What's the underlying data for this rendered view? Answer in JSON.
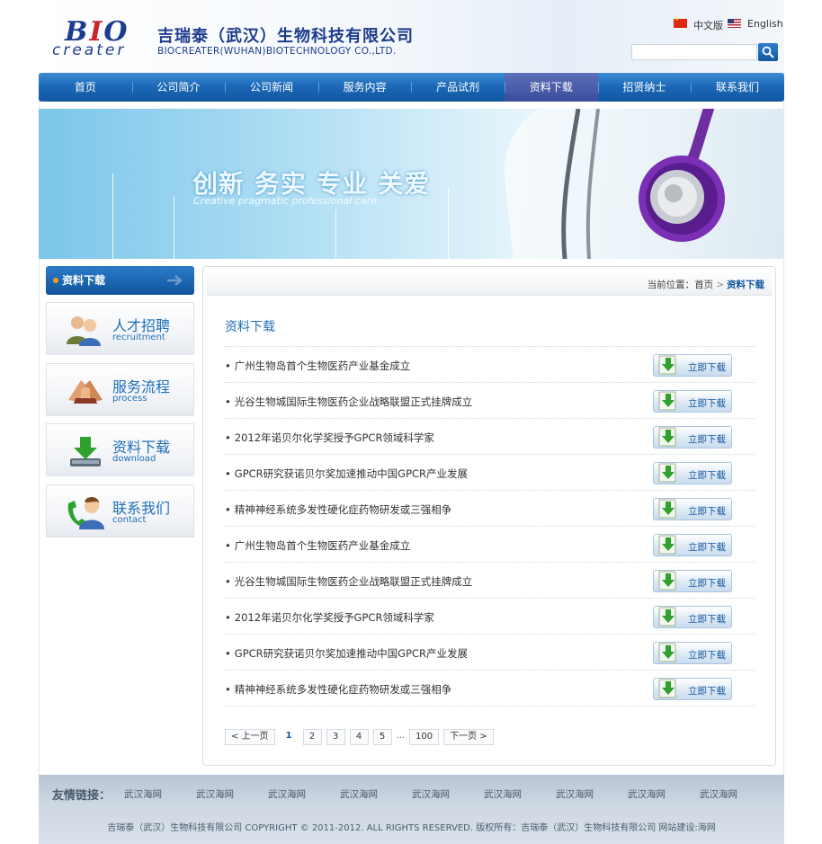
{
  "header": {
    "logo_bio": "BIO",
    "logo_creater": "creater",
    "company_cn": "吉瑞泰（武汉）生物科技有限公司",
    "company_en": "BIOCREATER(WUHAN)BIOTECHNOLOGY CO.,LTD.",
    "lang_cn": "中文版",
    "lang_en": "English",
    "search_value": ""
  },
  "nav": {
    "items": [
      {
        "label": "首页"
      },
      {
        "label": "公司简介"
      },
      {
        "label": "公司新闻"
      },
      {
        "label": "服务内容"
      },
      {
        "label": "产品试剂"
      },
      {
        "label": "资料下载"
      },
      {
        "label": "招贤纳士"
      },
      {
        "label": "联系我们"
      }
    ],
    "active": "资料下载"
  },
  "banner": {
    "slogan_cn": "创新 务实 专业 关爱",
    "slogan_en": "Creative pragmatic professional care"
  },
  "sidebar": {
    "title": "资料下载",
    "cards": [
      {
        "cn": "人才招聘",
        "en": "recruitment",
        "icon": "people-icon"
      },
      {
        "cn": "服务流程",
        "en": "process",
        "icon": "handshake-icon"
      },
      {
        "cn": "资料下载",
        "en": "download",
        "icon": "download-icon"
      },
      {
        "cn": "联系我们",
        "en": "contact",
        "icon": "phone-person-icon"
      }
    ]
  },
  "main": {
    "breadcrumb": {
      "prefix": "当前位置：",
      "home": "首页",
      "sep": ">",
      "current": "资料下载"
    },
    "title": "资料下载",
    "download_label": "立即下载",
    "items": [
      "广州生物岛首个生物医药产业基金成立",
      "光谷生物城国际生物医药企业战略联盟正式挂牌成立",
      "2012年诺贝尔化学奖授予GPCR领域科学家",
      "GPCR研究获诺贝尔奖加速推动中国GPCR产业发展",
      "精神神经系统多发性硬化症药物研发或三强相争",
      "广州生物岛首个生物医药产业基金成立",
      "光谷生物城国际生物医药企业战略联盟正式挂牌成立",
      "2012年诺贝尔化学奖授予GPCR领域科学家",
      "GPCR研究获诺贝尔奖加速推动中国GPCR产业发展",
      "精神神经系统多发性硬化症药物研发或三强相争"
    ],
    "pager": {
      "prev": "< 上一页",
      "pages": [
        "1",
        "2",
        "3",
        "4",
        "5"
      ],
      "current": "1",
      "ellipsis": "...",
      "last": "100",
      "next": "下一页 >"
    }
  },
  "footer": {
    "links_label": "友情链接：",
    "links": [
      "武汉海网",
      "武汉海网",
      "武汉海网",
      "武汉海网",
      "武汉海网",
      "武汉海网",
      "武汉海网",
      "武汉海网",
      "武汉海网"
    ],
    "copyright": "吉瑞泰（武汉）生物科技有限公司 COPYRIGHT © 2011-2012. ALL RIGHTS RESERVED.    版权所有：吉瑞泰（武汉）生物科技有限公司  网站建设:海网"
  },
  "colors": {
    "brand_blue": "#10569f",
    "nav_active": "#3a4b9c",
    "accent_red": "#c9252f",
    "download_green": "#2ea12e"
  }
}
